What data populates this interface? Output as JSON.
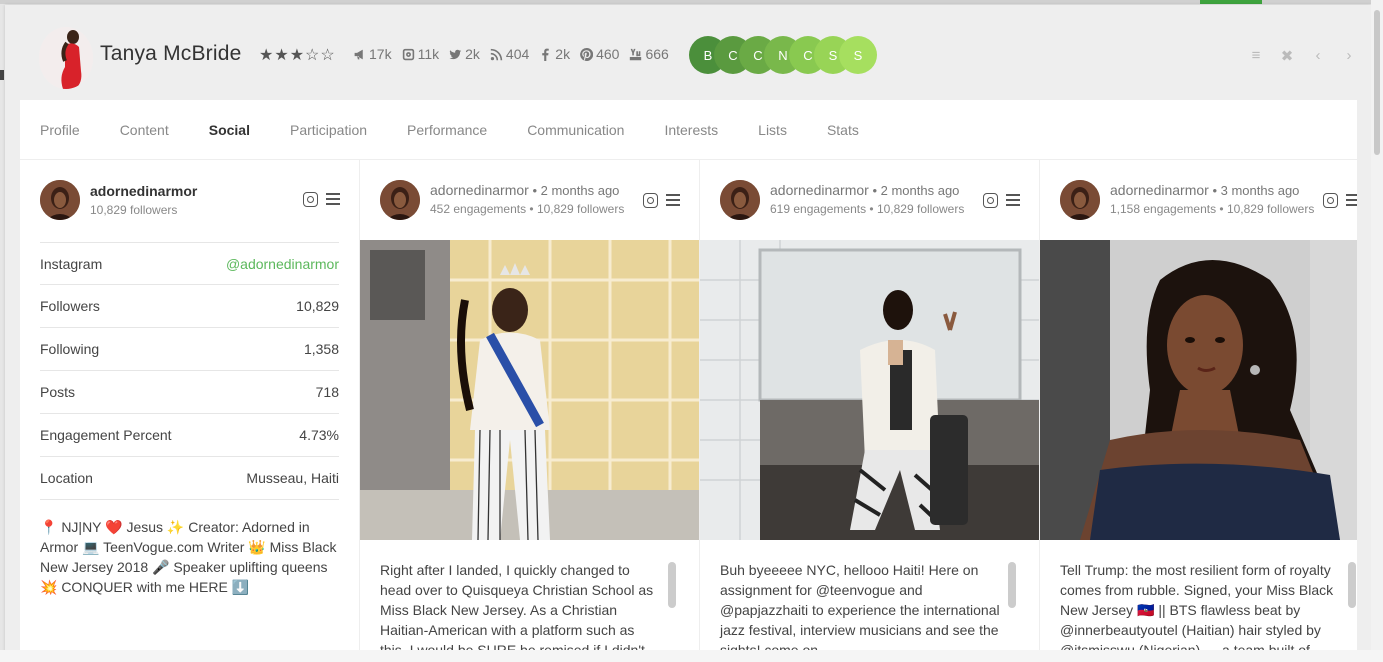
{
  "header": {
    "name": "Tanya McBride",
    "stars": "★★★☆☆",
    "stats": [
      {
        "icon": "megaphone-icon",
        "value": "17k"
      },
      {
        "icon": "instagram-icon",
        "value": "11k"
      },
      {
        "icon": "twitter-icon",
        "value": "2k"
      },
      {
        "icon": "rss-icon",
        "value": "404"
      },
      {
        "icon": "facebook-icon",
        "value": "2k"
      },
      {
        "icon": "pinterest-icon",
        "value": "460"
      },
      {
        "icon": "youtube-icon",
        "value": "666"
      }
    ],
    "chips": [
      {
        "letter": "B",
        "color": "#4b8f3b"
      },
      {
        "letter": "C",
        "color": "#5a9a3f"
      },
      {
        "letter": "C",
        "color": "#6aaa45"
      },
      {
        "letter": "N",
        "color": "#79b84b"
      },
      {
        "letter": "C",
        "color": "#89c950"
      },
      {
        "letter": "S",
        "color": "#98d456"
      },
      {
        "letter": "S",
        "color": "#a6df5f"
      }
    ],
    "controls": [
      "≡",
      "✖",
      "‹",
      "›"
    ]
  },
  "tabs": [
    "Profile",
    "Content",
    "Social",
    "Participation",
    "Performance",
    "Communication",
    "Interests",
    "Lists",
    "Stats"
  ],
  "active_tab": "Social",
  "profile": {
    "username": "adornedinarmor",
    "followers_text": "10,829 followers",
    "rows": [
      {
        "label": "Instagram",
        "value": "@adornedinarmor",
        "link": true
      },
      {
        "label": "Followers",
        "value": "10,829"
      },
      {
        "label": "Following",
        "value": "1,358"
      },
      {
        "label": "Posts",
        "value": "718"
      },
      {
        "label": "Engagement Percent",
        "value": "4.73%"
      },
      {
        "label": "Location",
        "value": "Musseau, Haiti"
      }
    ],
    "bio": "📍 NJ|NY ❤️ Jesus ✨ Creator: Adorned in Armor 💻 TeenVogue.com Writer 👑 Miss Black New Jersey 2018 🎤 Speaker uplifting queens💥 CONQUER with me HERE ⬇️"
  },
  "posts": [
    {
      "username": "adornedinarmor",
      "time": "• 2 months ago",
      "meta": "452 engagements • 10,829 followers",
      "caption": "Right after I landed, I quickly changed to head over to Quisqueya Christian School as Miss Black New Jersey. As a Christian Haitian-American with a platform such as this, I would be SURE be remised if I didn't"
    },
    {
      "username": "adornedinarmor",
      "time": "• 2 months ago",
      "meta": "619 engagements • 10,829 followers",
      "caption": "Buh byeeeee NYC, hellooo Haiti! Here on assignment for @teenvogue and @papjazzhaiti to experience the international jazz festival, interview musicians and see the sights! come on"
    },
    {
      "username": "adornedinarmor",
      "time": "• 3 months ago",
      "meta": "1,158 engagements • 10,829 followers",
      "caption": "Tell Trump: the most resilient form of royalty comes from rubble. Signed, your Miss Black New Jersey 🇭🇹 || BTS flawless beat by @innerbeautyoutel (Haitian) hair styled by @itsmisswu (Nigerian) — a team built of"
    }
  ]
}
